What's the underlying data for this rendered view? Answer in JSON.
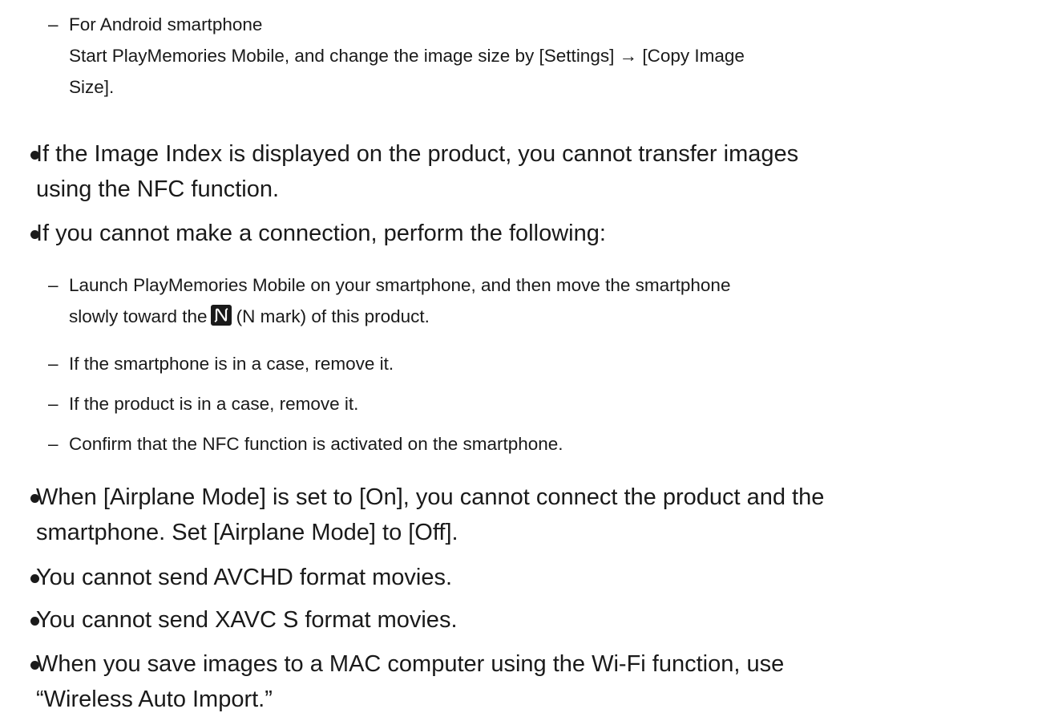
{
  "android_sub": {
    "dash": "–",
    "title": "For Android smartphone",
    "line1": "Start PlayMemories Mobile, and change the image size by [Settings] → [Copy Image",
    "line2": "Size]."
  },
  "bullets": {
    "image_index_line1": "If the Image Index is displayed on the product, you cannot transfer images",
    "image_index_line2": "using the NFC function.",
    "cannot_connect": "If you cannot make a connection, perform the following:",
    "airplane_line1": "When [Airplane Mode] is set to [On], you cannot connect the product and the",
    "airplane_line2": "smartphone. Set [Airplane Mode] to [Off].",
    "avchd": "You cannot send AVCHD format movies.",
    "xavc": "You cannot send XAVC S format movies.",
    "mac_line1": "When you save images to a MAC computer using the Wi-Fi function, use",
    "mac_line2": "“Wireless Auto Import.”"
  },
  "connection_steps": {
    "launch_line1": "Launch PlayMemories Mobile on your smartphone, and then move the smartphone",
    "launch_line2_before": "slowly toward the",
    "launch_line2_after": "(N mark) of this product.",
    "smartphone_case": "If the smartphone is in a case, remove it.",
    "product_case": "If the product is in a case, remove it.",
    "confirm_nfc": "Confirm that the NFC function is activated on the smartphone."
  },
  "icons": {
    "n_mark": "nfc-n-mark-icon"
  }
}
